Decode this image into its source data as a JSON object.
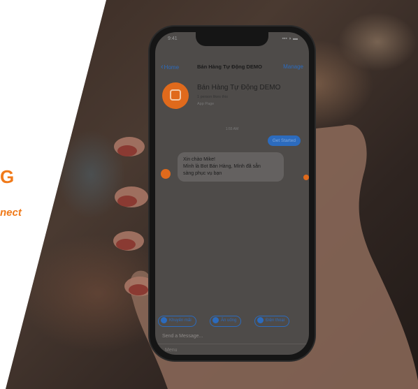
{
  "left_panel": {
    "headline_fragment": "G",
    "subline_fragment": "nect"
  },
  "colors": {
    "brand_orange": "#f07a1a",
    "messenger_blue": "#2c6bbd"
  },
  "status_bar": {
    "time": "9:41",
    "icons": "▪▪▪ ◗ ▬"
  },
  "nav": {
    "back_label": "Home",
    "title": "Bán Hàng Tự Động DEMO",
    "manage_label": "Manage"
  },
  "profile": {
    "name": "Bán Hàng Tự Động DEMO",
    "meta": "1 person likes this",
    "category": "App Page"
  },
  "conversation": {
    "timestamp": "1:55 AM",
    "user_message": "Get Started",
    "bot_message_lines": [
      "Xin chào Mike!",
      "Mình là Bot Bán Hàng, Mình đã sẵn",
      "sàng phục vụ bạn"
    ]
  },
  "quick_replies": [
    {
      "label": "Khuyến mãi",
      "icon": "offer-icon"
    },
    {
      "label": "Ăn uống",
      "icon": "food-icon"
    },
    {
      "label": "Điện thoại",
      "icon": "phone-icon"
    }
  ],
  "composer": {
    "placeholder": "Send a Message...",
    "secondary": "Menu"
  }
}
